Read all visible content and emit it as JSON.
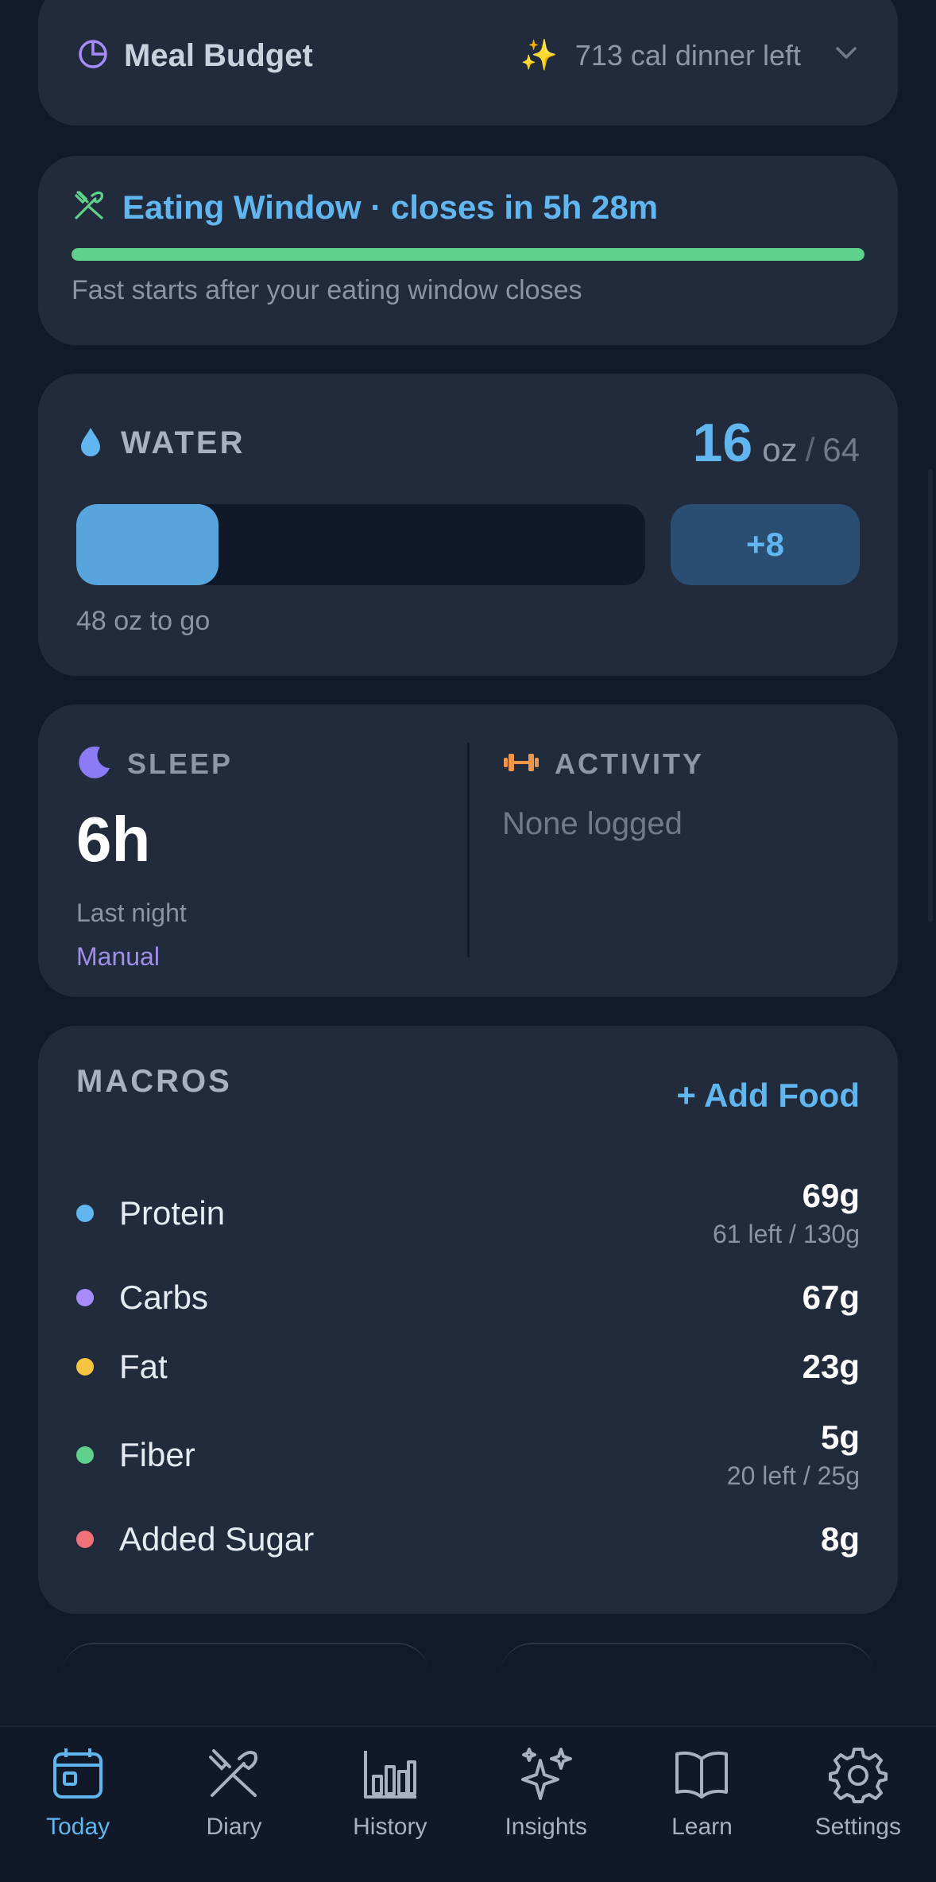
{
  "meal_budget": {
    "title": "Meal Budget",
    "summary": "713 cal dinner left",
    "icon": "pie-chart-icon"
  },
  "eating_window": {
    "title": "Eating Window · closes in 5h 28m",
    "subtitle": "Fast starts after your eating window closes",
    "progress": 1.0,
    "color": "#5fd18c"
  },
  "water": {
    "label": "WATER",
    "current": "16",
    "unit": "oz",
    "separator": "/",
    "goal": "64",
    "progress": 0.25,
    "add_button": "+8",
    "remaining": "48 oz to go"
  },
  "sleep": {
    "label": "SLEEP",
    "value": "6h",
    "subtitle": "Last night",
    "source": "Manual"
  },
  "activity": {
    "label": "ACTIVITY",
    "value": "None logged"
  },
  "macros": {
    "title": "MACROS",
    "add_food": "+ Add Food",
    "items": [
      {
        "name": "Protein",
        "value": "69g",
        "left": "61 left / 130g",
        "color": "#62b6f0"
      },
      {
        "name": "Carbs",
        "value": "67g",
        "left": "",
        "color": "#a78bfa"
      },
      {
        "name": "Fat",
        "value": "23g",
        "left": "",
        "color": "#f5c542"
      },
      {
        "name": "Fiber",
        "value": "5g",
        "left": "20 left / 25g",
        "color": "#5fd18c"
      },
      {
        "name": "Added Sugar",
        "value": "8g",
        "left": "",
        "color": "#f07178"
      }
    ]
  },
  "tabs": [
    {
      "label": "Today",
      "icon": "calendar-icon",
      "active": true
    },
    {
      "label": "Diary",
      "icon": "fork-knife-icon",
      "active": false
    },
    {
      "label": "History",
      "icon": "bar-chart-icon",
      "active": false
    },
    {
      "label": "Insights",
      "icon": "sparkles-icon",
      "active": false
    },
    {
      "label": "Learn",
      "icon": "book-icon",
      "active": false
    },
    {
      "label": "Settings",
      "icon": "gear-icon",
      "active": false
    }
  ]
}
